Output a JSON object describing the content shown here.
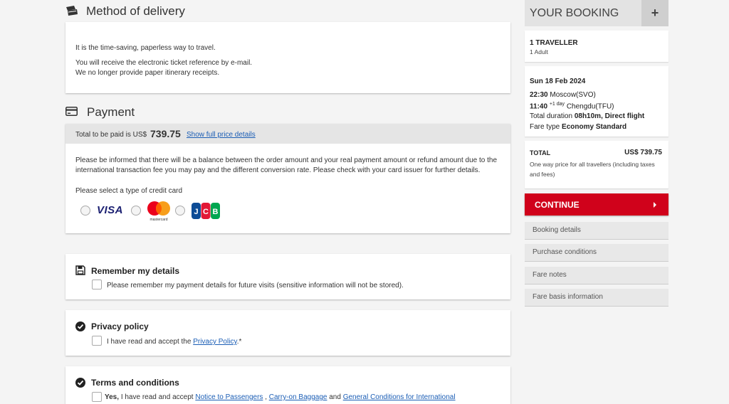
{
  "delivery": {
    "title": "Method of delivery",
    "line1": "It is the time-saving, paperless way to travel.",
    "line2": "You will receive the electronic ticket reference by e-mail.",
    "line3": "We no longer provide paper itinerary receipts."
  },
  "payment": {
    "title": "Payment",
    "total_prefix": "Total to be paid is US$",
    "total_amount": "739.75",
    "show_details_link": "Show full price details",
    "notice": "Please be informed that there will be a balance between the order amount and your real payment amount or refund amount due to the international transaction fee you may pay and the different conversion rate. Please check with your card issuer for further details.",
    "select_card_label": "Please select a type of credit card",
    "cards": [
      {
        "name": "VISA",
        "icon": "visa-logo"
      },
      {
        "name": "mastercard",
        "icon": "mastercard-logo"
      },
      {
        "name": "JCB",
        "icon": "jcb-logo"
      }
    ]
  },
  "remember": {
    "title": "Remember my details",
    "checkbox_label": "Please remember my payment details for future visits (sensitive information will not be stored)."
  },
  "privacy": {
    "title": "Privacy policy",
    "prefix": "I have read and accept the",
    "link": "Privacy Policy",
    "suffix": ".*"
  },
  "terms": {
    "title": "Terms and conditions",
    "yes": "Yes,",
    "prefix": "I have read and accept",
    "link1": "Notice to Passengers",
    "sep": ",",
    "link2": "Carry-on Baggage",
    "and": "and",
    "link3": "General Conditions for International"
  },
  "booking": {
    "title": "YOUR BOOKING",
    "expand_symbol": "+",
    "travellers": "1 TRAVELLER",
    "adults": "1 Adult",
    "date": "Sun 18 Feb 2024",
    "dep_time": "22:30",
    "dep_place": "Moscow(SVO)",
    "arr_time": "11:40",
    "arr_offset": "+1 day",
    "arr_place": "Chengdu(TFU)",
    "duration_label": "Total duration",
    "duration_value": "08h10m, Direct flight",
    "fare_label": "Fare type",
    "fare_value": "Economy Standard",
    "total_label": "TOTAL",
    "total_value": "US$ 739.75",
    "total_note": "One way price for all travellers (including taxes and fees)",
    "continue_label": "CONTINUE",
    "links": [
      "Booking details",
      "Purchase conditions",
      "Fare notes",
      "Fare basis information"
    ]
  },
  "colors": {
    "accent_red": "#d0021b",
    "link_blue": "#1a5db5",
    "background": "#f4f4f4"
  }
}
